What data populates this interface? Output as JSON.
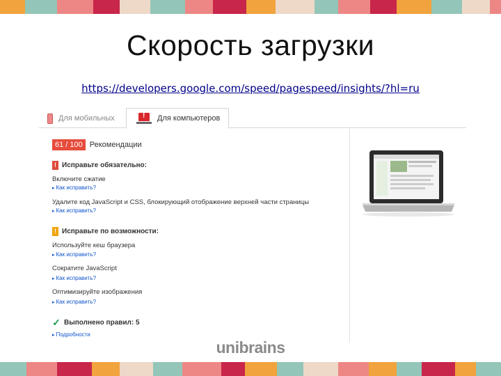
{
  "slide": {
    "title": "Скорость загрузки",
    "url": "https://developers.google.com/speed/pagespeed/insights/?hl=ru",
    "logo": "unibrains",
    "stripe_colors": [
      "#f1a33d",
      "#93c6b8",
      "#ec8785",
      "#c8264b",
      "#eed9c8",
      "#93c6b8",
      "#ec8785",
      "#c8264b",
      "#f1a33d",
      "#eed9c8",
      "#93c6b8",
      "#ec8785",
      "#c8264b",
      "#f1a33d",
      "#93c6b8",
      "#eed9c8",
      "#ec8785",
      "#f1a33d",
      "#93c6b8",
      "#c8264b"
    ]
  },
  "screenshot": {
    "tabs": [
      {
        "label": "Для мобильных",
        "icon": "phone-icon",
        "active": false
      },
      {
        "label": "Для компьютеров",
        "icon": "monitor-warning-icon",
        "active": true
      }
    ],
    "score": "61 / 100",
    "score_label": "Рекомендации",
    "sections": [
      {
        "title": "Исправьте обязательно:",
        "badge": "!",
        "color": "#dd4b39",
        "rules": [
          {
            "text": "Включите сжатие",
            "link": "Как исправить?"
          },
          {
            "text": "Удалите код JavaScript и CSS, блокирующий отображение верхней части страницы",
            "link": "Как исправить?"
          }
        ]
      },
      {
        "title": "Исправьте по возможности:",
        "badge": "!",
        "color": "#f0a30a",
        "rules": [
          {
            "text": "Используйте кеш браузера",
            "link": "Как исправить?"
          },
          {
            "text": "Сократите JavaScript",
            "link": "Как исправить?"
          },
          {
            "text": "Оптимизируйте изображения",
            "link": "Как исправить?"
          }
        ]
      },
      {
        "title": "Выполнено правил: 5",
        "badge": "✓",
        "color": "#1a9e4b",
        "rules": [
          {
            "text": "",
            "link": "Подробности"
          }
        ]
      }
    ],
    "preview_icon": "laptop-preview-image"
  }
}
